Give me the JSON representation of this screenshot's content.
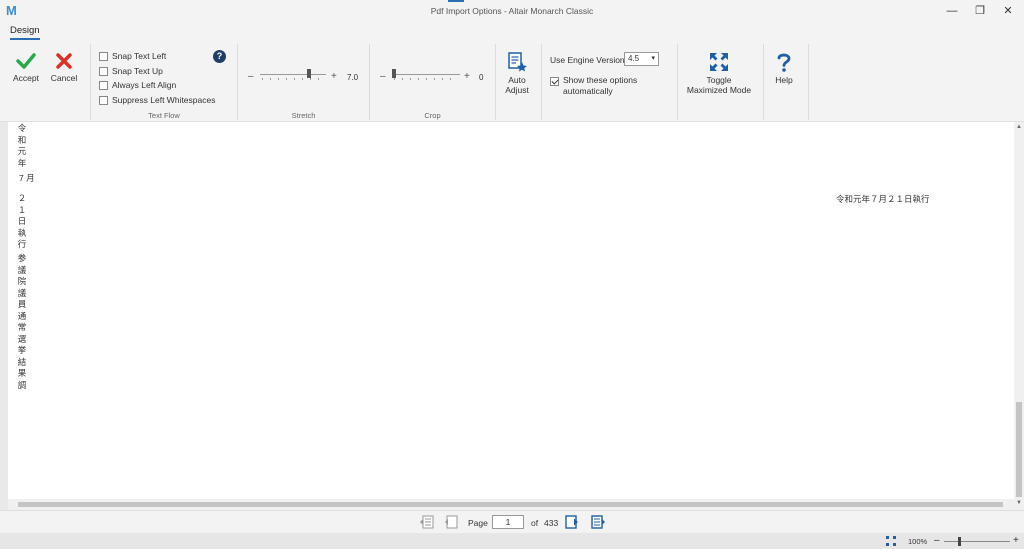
{
  "window": {
    "app_logo": "M",
    "title": "Pdf Import Options - Altair Monarch Classic",
    "minimize": "—",
    "restore": "❐",
    "close": "✕"
  },
  "tabs": {
    "design": "Design"
  },
  "ribbon": {
    "accept": "Accept",
    "cancel": "Cancel",
    "text_flow": {
      "label": "Text Flow",
      "options": [
        {
          "label": "Snap Text Left",
          "checked": false
        },
        {
          "label": "Snap Text Up",
          "checked": false
        },
        {
          "label": "Always Left Align",
          "checked": false
        },
        {
          "label": "Suppress Left Whitespaces",
          "checked": false
        }
      ],
      "help": "?"
    },
    "stretch": {
      "label": "Stretch",
      "minus": "–",
      "plus": "+",
      "value": "7.0",
      "level": 0.75
    },
    "crop": {
      "label": "Crop",
      "minus": "–",
      "plus": "+",
      "value": "0",
      "level": 0.0
    },
    "auto_adjust": {
      "line1": "Auto",
      "line2": "Adjust"
    },
    "engine": {
      "label": "Use Engine Version",
      "version": "4.5",
      "show_options_line1": "Show these options",
      "show_options_line2": "automatically",
      "show_options_checked": true
    },
    "toggle_max": {
      "line1": "Toggle",
      "line2": "Maximized Mode"
    },
    "help": "Help",
    "colors": {
      "accept": "#2aa84a",
      "cancel": "#d9302a",
      "accent": "#2d6fb5"
    }
  },
  "document": {
    "col1_a": "令和元年",
    "col1_b": "7 月",
    "col1_c": "２１日執行",
    "col1_d": "参議院議員通常選挙結果調",
    "right_text": "令和元年７月２１日執行"
  },
  "pagenav": {
    "page_label": "Page",
    "page_value": "1",
    "of_label": "of",
    "total": "433"
  },
  "status": {
    "zoom": "100%",
    "minus": "–",
    "plus": "+"
  }
}
